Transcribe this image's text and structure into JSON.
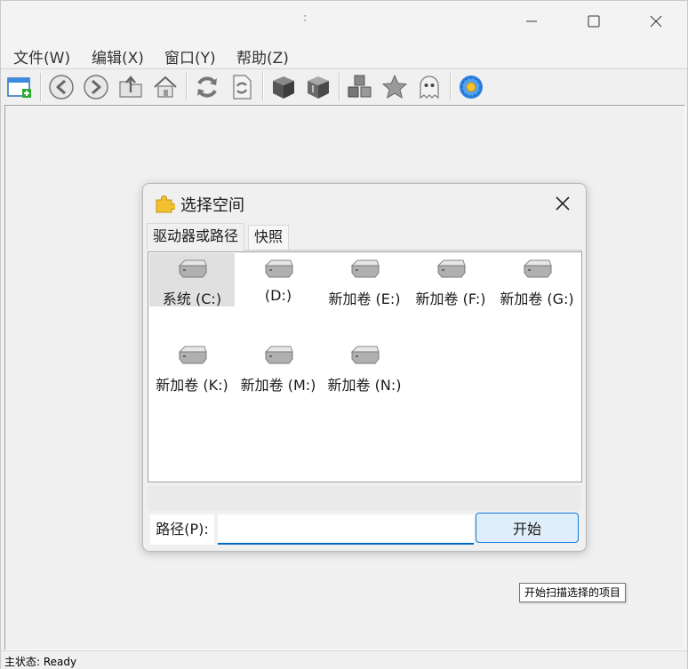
{
  "window": {
    "title": ":"
  },
  "menu": {
    "items": [
      "文件(W)",
      "编辑(X)",
      "窗口(Y)",
      "帮助(Z)"
    ]
  },
  "toolbar": {
    "buttons": [
      "new-window-icon",
      "back-icon",
      "forward-icon",
      "up-folder-icon",
      "home-icon",
      "refresh-icon",
      "refresh-document-icon",
      "box-dark-icon",
      "box-lid-icon",
      "cubes-icon",
      "star-icon",
      "ghost-icon",
      "gear-flower-icon"
    ]
  },
  "dialog": {
    "title": "选择空间",
    "tabs": [
      "驱动器或路径",
      "快照"
    ],
    "drives": [
      {
        "label": "系统 (C:)",
        "selected": true
      },
      {
        "label": "(D:)"
      },
      {
        "label": "新加卷 (E:)"
      },
      {
        "label": "新加卷 (F:)"
      },
      {
        "label": "新加卷 (G:)"
      },
      {
        "label": "新加卷 (K:)"
      },
      {
        "label": "新加卷 (M:)"
      },
      {
        "label": "新加卷 (N:)"
      }
    ],
    "path_label": "路径(P):",
    "path_value": "",
    "start_label": "开始"
  },
  "tooltip": "开始扫描选择的项目",
  "status": "主状态: Ready",
  "colors": {
    "accent": "#0067c0",
    "button_bg": "#e0eef9"
  }
}
